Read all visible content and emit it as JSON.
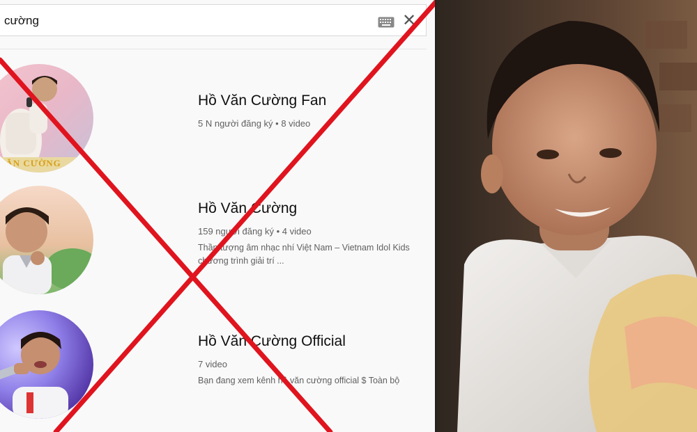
{
  "search": {
    "query": "cường"
  },
  "icons": {
    "keyboard": "keyboard-icon",
    "clear": "close-icon"
  },
  "results": [
    {
      "name": "Hồ Văn Cường Fan",
      "meta": "5 N người đăng ký • 8 video",
      "description": []
    },
    {
      "name": "Hồ Văn Cường",
      "meta": "159 người đăng ký • 4 video",
      "description": [
        "Thần tượng âm nhạc nhí Việt Nam – Vietnam Idol Kids",
        "chương trình giải trí ..."
      ]
    },
    {
      "name": "Hồ Văn Cường Official",
      "meta": "7 video",
      "description": [
        "Bạn đang xem kênh hồ văn cường official $ Toàn bộ"
      ]
    }
  ],
  "avatar_text": "VĂN CƯỜNG",
  "colors": {
    "cross": "#e0141e",
    "background": "#f9f9f9",
    "text_primary": "#0f0f0f",
    "text_secondary": "#606060"
  }
}
